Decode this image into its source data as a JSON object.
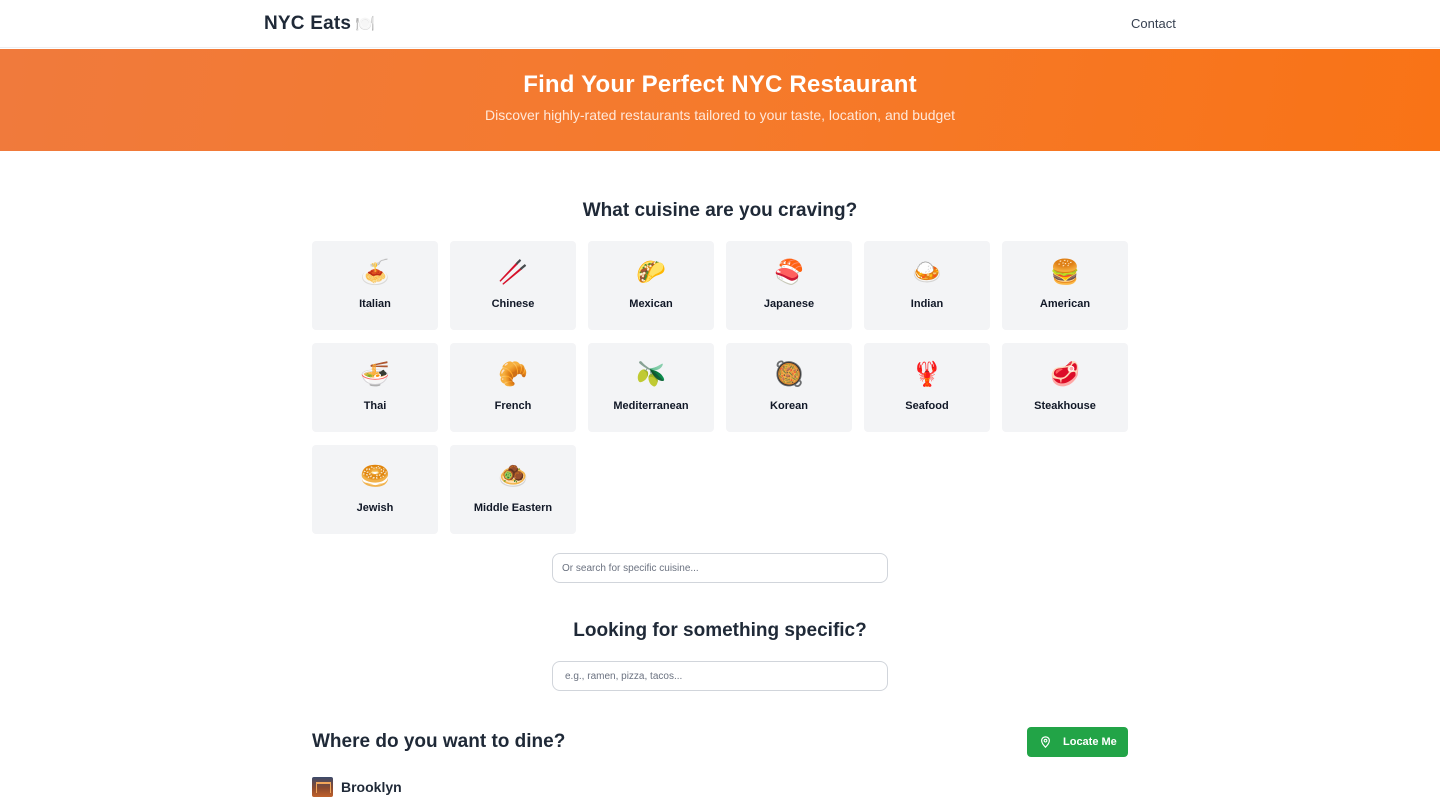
{
  "nav": {
    "brand": "NYC Eats",
    "brand_icon": "🍽️",
    "contact_label": "Contact"
  },
  "hero": {
    "title": "Find Your Perfect NYC Restaurant",
    "subtitle": "Discover highly-rated restaurants tailored to your taste, location, and budget",
    "accent_color": "#f97316"
  },
  "cuisine": {
    "title": "What cuisine are you craving?",
    "items": [
      {
        "label": "Italian",
        "icon": "🍝",
        "icon_name": "spaghetti-icon"
      },
      {
        "label": "Chinese",
        "icon": "🥢",
        "icon_name": "chopsticks-icon"
      },
      {
        "label": "Mexican",
        "icon": "🌮",
        "icon_name": "taco-icon"
      },
      {
        "label": "Japanese",
        "icon": "🍣",
        "icon_name": "sushi-icon"
      },
      {
        "label": "Indian",
        "icon": "🍛",
        "icon_name": "curry-icon"
      },
      {
        "label": "American",
        "icon": "🍔",
        "icon_name": "burger-icon"
      },
      {
        "label": "Thai",
        "icon": "🍜",
        "icon_name": "noodle-bowl-icon"
      },
      {
        "label": "French",
        "icon": "🥐",
        "icon_name": "croissant-icon"
      },
      {
        "label": "Mediterranean",
        "icon": "🫒",
        "icon_name": "olive-icon"
      },
      {
        "label": "Korean",
        "icon": "🥘",
        "icon_name": "paella-pan-icon"
      },
      {
        "label": "Seafood",
        "icon": "🦞",
        "icon_name": "lobster-icon"
      },
      {
        "label": "Steakhouse",
        "icon": "🥩",
        "icon_name": "steak-icon"
      },
      {
        "label": "Jewish",
        "icon": "🥯",
        "icon_name": "bagel-icon"
      },
      {
        "label": "Middle Eastern",
        "icon": "🧆",
        "icon_name": "falafel-icon"
      }
    ],
    "search_placeholder": "Or search for specific cuisine..."
  },
  "specific": {
    "title": "Looking for something specific?",
    "placeholder": "e.g., ramen, pizza, tacos..."
  },
  "location": {
    "title": "Where do you want to dine?",
    "locate_label": "Locate Me",
    "locate_color": "#22a447",
    "boroughs": [
      {
        "name": "Brooklyn"
      }
    ]
  }
}
